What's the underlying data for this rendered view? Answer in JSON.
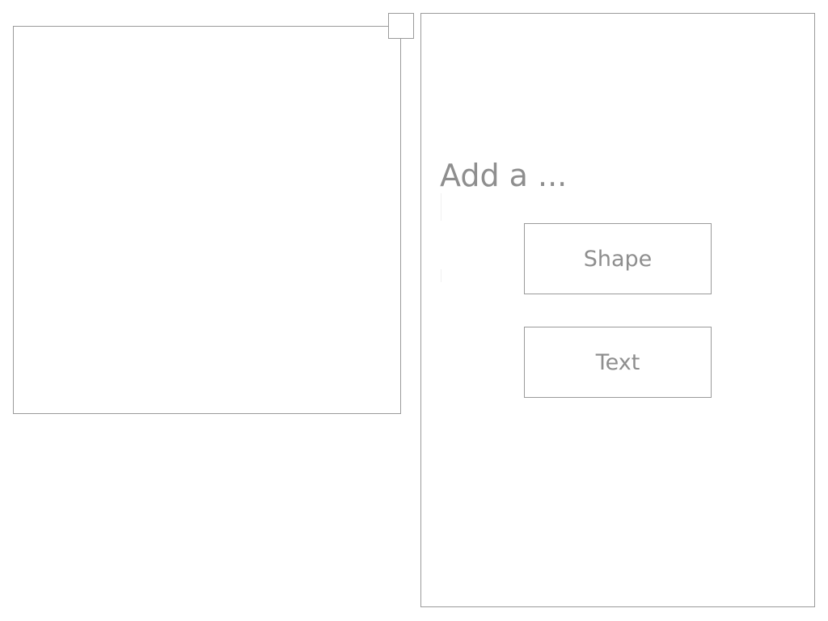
{
  "panel": {
    "heading": "Add a ...",
    "buttons": {
      "shape_label": "Shape",
      "text_label": "Text"
    }
  },
  "colors": {
    "border": "#9a9a9a",
    "text": "#8e8e8e",
    "background": "#ffffff"
  }
}
